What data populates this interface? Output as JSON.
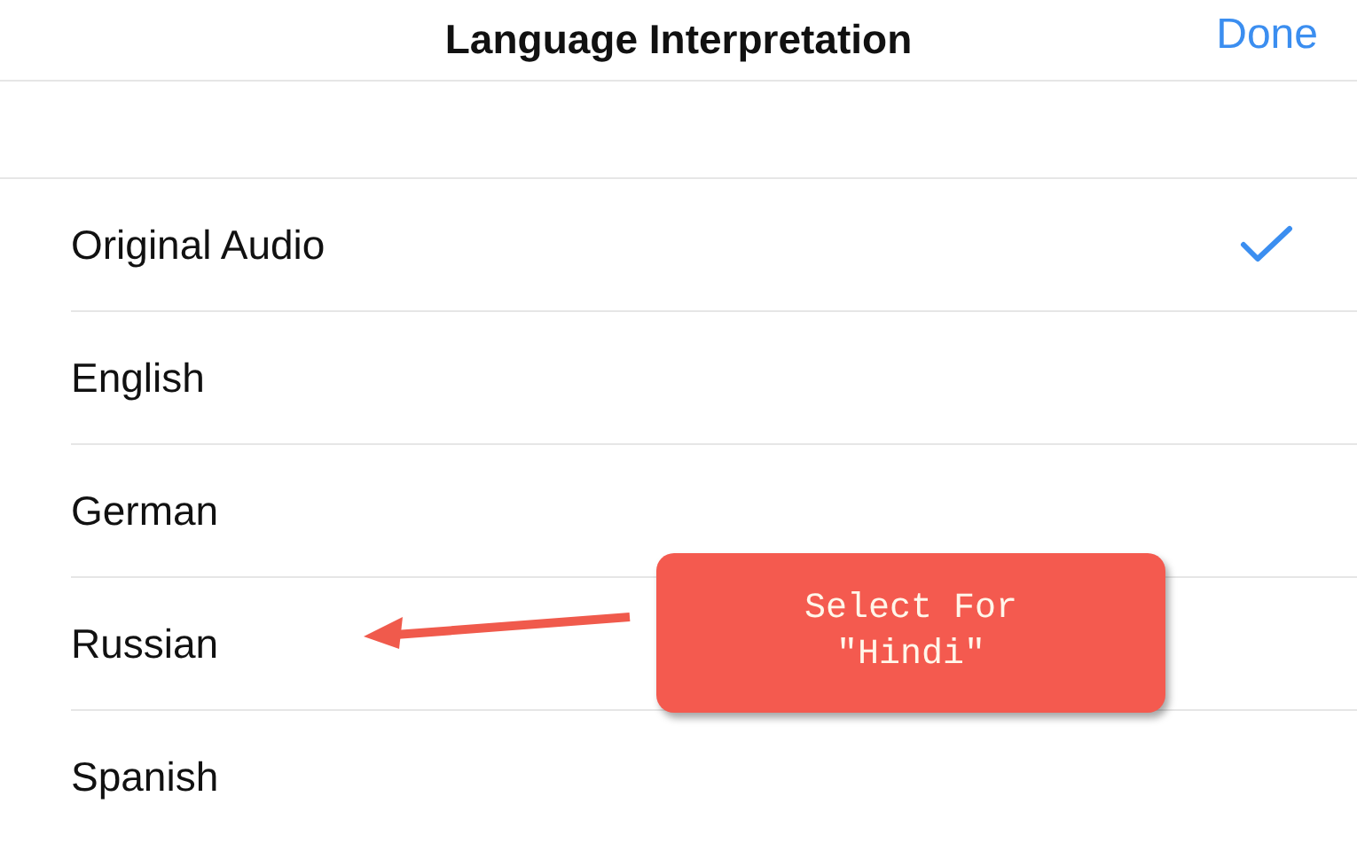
{
  "header": {
    "title": "Language Interpretation",
    "done": "Done"
  },
  "languages": [
    {
      "label": "Original Audio",
      "selected": true
    },
    {
      "label": "English",
      "selected": false
    },
    {
      "label": "German",
      "selected": false
    },
    {
      "label": "Russian",
      "selected": false
    },
    {
      "label": "Spanish",
      "selected": false
    }
  ],
  "callout": {
    "text": "Select For\n\"Hindi\""
  }
}
